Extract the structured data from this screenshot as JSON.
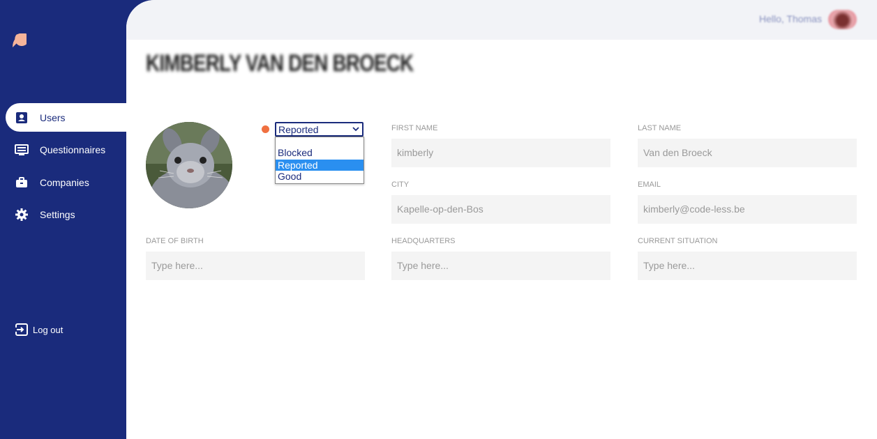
{
  "user": {
    "greeting": "Hello, Thomas"
  },
  "profile": {
    "name": "KIMBERLY VAN DEN BROECK",
    "avatar_subject": "rabbit-photo"
  },
  "sidebar": {
    "items": [
      {
        "label": "Users",
        "icon": "user-badge-icon",
        "active": true
      },
      {
        "label": "Questionnaires",
        "icon": "list-icon",
        "active": false
      },
      {
        "label": "Companies",
        "icon": "briefcase-icon",
        "active": false
      },
      {
        "label": "Settings",
        "icon": "gear-icon",
        "active": false
      }
    ],
    "logout": "Log out"
  },
  "status": {
    "selected": "Reported",
    "options": [
      "Blocked",
      "Reported",
      "Good"
    ],
    "dot_color": "#f07040"
  },
  "fields": {
    "first_name": {
      "label": "FIRST NAME",
      "value": "kimberly"
    },
    "last_name": {
      "label": "LAST NAME",
      "value": "Van den Broeck"
    },
    "city": {
      "label": "CITY",
      "value": "Kapelle-op-den-Bos"
    },
    "email": {
      "label": "EMAIL",
      "value": "kimberly@code-less.be"
    },
    "date_of_birth": {
      "label": "DATE OF BIRTH",
      "placeholder": "Type here..."
    },
    "headquarters": {
      "label": "HEADQUARTERS",
      "placeholder": "Type here..."
    },
    "current_situation": {
      "label": "CURRENT SITUATION",
      "placeholder": "Type here..."
    }
  },
  "colors": {
    "sidebar": "#1a2b7c",
    "accent": "#2a8ff0",
    "logo": "#f5b49a"
  }
}
